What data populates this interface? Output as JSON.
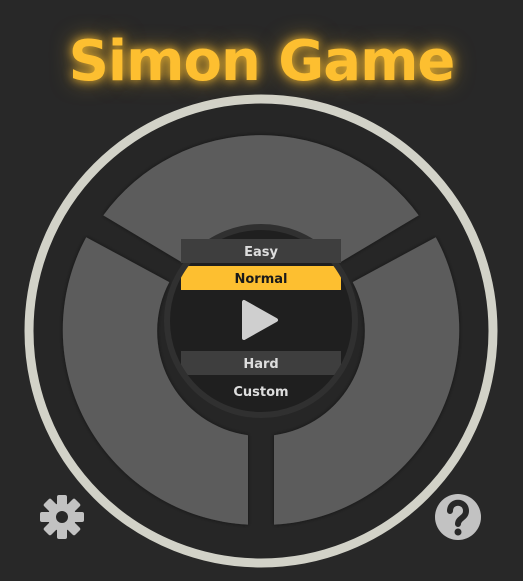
{
  "title": "Simon Game",
  "menu": {
    "easy": "Easy",
    "normal": "Normal",
    "hard": "Hard",
    "custom": "Custom",
    "selected": "normal"
  },
  "icons": {
    "play": "play-icon",
    "settings": "gear-icon",
    "help": "question-mark-icon"
  },
  "colors": {
    "background": "#282828",
    "ring": "#d2d2c8",
    "pad": "#5b5b5b",
    "accent": "#fdbf30"
  }
}
